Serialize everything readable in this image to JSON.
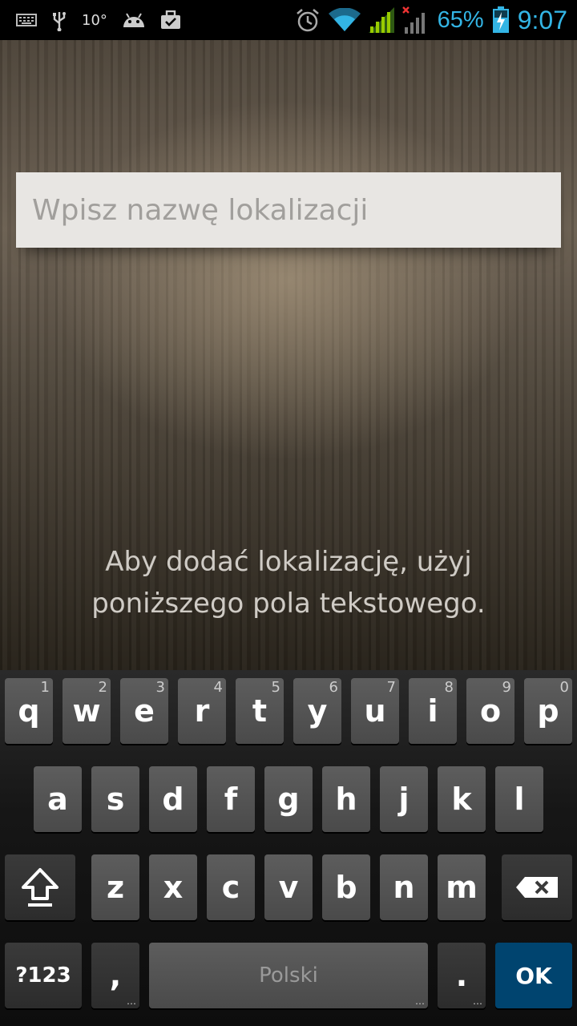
{
  "status_bar": {
    "icons_left": [
      "keyboard-icon",
      "usb-icon",
      "temperature-icon",
      "android-debug-icon",
      "briefcase-icon"
    ],
    "temperature": "10°",
    "icons_right": [
      "alarm-icon",
      "wifi-icon",
      "signal-icon",
      "signal-no-data-icon",
      "battery-charging-icon"
    ],
    "battery_percent": "65%",
    "time": "9:07",
    "accent_color": "#33b5e5"
  },
  "main": {
    "location_input": {
      "value": "",
      "placeholder": "Wpisz nazwę lokalizacji"
    },
    "hint_line1": "Aby dodać lokalizację, użyj",
    "hint_line2": "poniższego pola tekstowego."
  },
  "keyboard": {
    "row1": [
      {
        "label": "q",
        "hint": "1"
      },
      {
        "label": "w",
        "hint": "2"
      },
      {
        "label": "e",
        "hint": "3"
      },
      {
        "label": "r",
        "hint": "4"
      },
      {
        "label": "t",
        "hint": "5"
      },
      {
        "label": "y",
        "hint": "6"
      },
      {
        "label": "u",
        "hint": "7"
      },
      {
        "label": "i",
        "hint": "8"
      },
      {
        "label": "o",
        "hint": "9"
      },
      {
        "label": "p",
        "hint": "0"
      }
    ],
    "row2": [
      "a",
      "s",
      "d",
      "f",
      "g",
      "h",
      "j",
      "k",
      "l"
    ],
    "row3": [
      "z",
      "x",
      "c",
      "v",
      "b",
      "n",
      "m"
    ],
    "symbols_key": "?123",
    "comma_key": ",",
    "space_label": "Polski",
    "period_key": ".",
    "ok_key": "OK",
    "ok_color": "#00446f"
  }
}
